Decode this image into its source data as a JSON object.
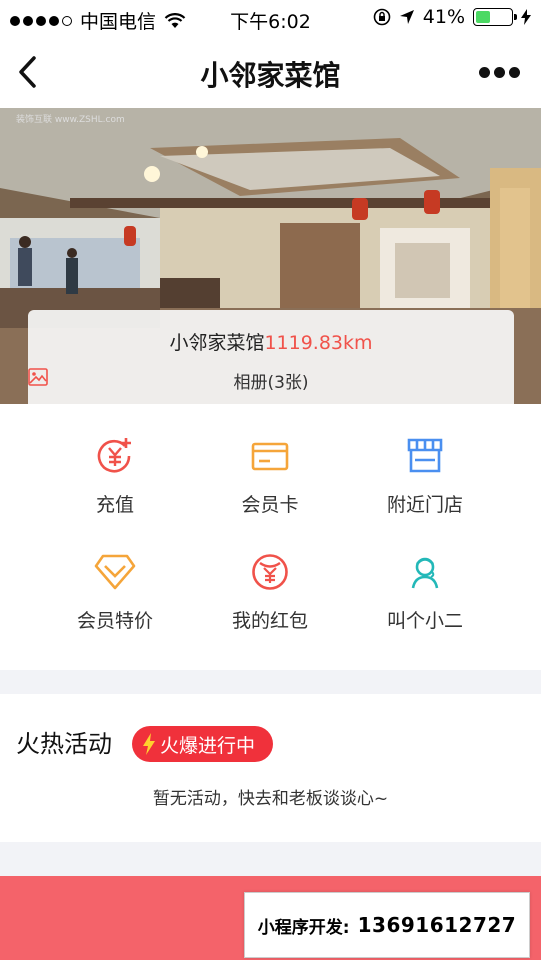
{
  "status_bar": {
    "carrier": "中国电信",
    "time": "下午6:02",
    "battery_percent": "41%",
    "battery_level": 0.41,
    "icons": [
      "signal-dots-icon",
      "wifi-icon",
      "rotation-lock-icon",
      "location-arrow-icon",
      "battery-icon",
      "charging-bolt-icon"
    ]
  },
  "nav": {
    "title": "小邻家菜馆",
    "back_icon": "chevron-left-icon",
    "more_icon": "more-dots-icon"
  },
  "hero": {
    "watermark": "装饰互联 www.ZSHL.com",
    "store_name": "小邻家菜馆",
    "distance": "1119.83km",
    "album_label": "相册(3张)",
    "album_icon": "image-icon"
  },
  "grid": {
    "items": [
      {
        "label": "充值",
        "icon": "recharge-yen-plus-icon",
        "color": "#f0524a"
      },
      {
        "label": "会员卡",
        "icon": "membership-card-icon",
        "color": "#f5a53a"
      },
      {
        "label": "附近门店",
        "icon": "store-awning-icon",
        "color": "#4a8ff0"
      },
      {
        "label": "会员特价",
        "icon": "diamond-icon",
        "color": "#f5a53a"
      },
      {
        "label": "我的红包",
        "icon": "red-packet-yen-icon",
        "color": "#f0524a"
      },
      {
        "label": "叫个小二",
        "icon": "waiter-icon",
        "color": "#23b8b8"
      }
    ]
  },
  "activity": {
    "title": "火热活动",
    "badge": "火爆进行中",
    "badge_icon": "lightning-icon",
    "empty_text": "暂无活动，快去和老板谈谈心~"
  },
  "bottom": {
    "dev_label": "小程序开发:",
    "dev_phone": "13691612727"
  },
  "colors": {
    "accent_red": "#f0524a",
    "badge_red": "#f0313b",
    "bottom_bar": "#f4636a",
    "page_bg": "#f2f3f7"
  }
}
